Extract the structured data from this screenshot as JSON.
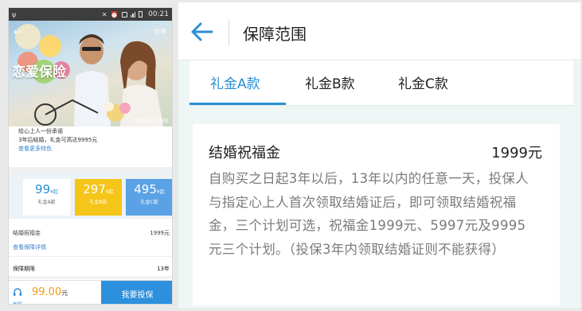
{
  "phone": {
    "status": {
      "time": "00:21"
    },
    "hero": {
      "share": "分享",
      "title": "恋爱保险"
    },
    "intro": {
      "line1": "给心上人一份承诺",
      "line2": "3年后结婚，礼金可高达9995元",
      "more": "查看更多特色"
    },
    "plans": [
      {
        "amount": "99",
        "unit": "¥起",
        "name": "礼金A款"
      },
      {
        "amount": "297",
        "unit": "¥起",
        "name": "礼金B款"
      },
      {
        "amount": "495",
        "unit": "¥起",
        "name": "礼金C款"
      }
    ],
    "coverage_row": {
      "label": "结婚祝福金",
      "value": "1999元"
    },
    "coverage_link": "查看保障详情",
    "period_row": {
      "label": "保障期限",
      "value": "13年"
    },
    "bottom": {
      "service_label": "客服",
      "price": "99.00",
      "price_unit": "元",
      "buy": "我要投保"
    }
  },
  "detail": {
    "title": "保障范围",
    "tabs": [
      "礼金A款",
      "礼金B款",
      "礼金C款"
    ],
    "active_tab": 0,
    "card": {
      "title": "结婚祝福金",
      "amount": "1999元",
      "description": "自购买之日起3年以后，13年以内的任意一天，投保人与指定心上人首次领取结婚证后，即可领取结婚祝福金，三个计划可选，祝福金1999元、5997元及9995元三个计划。（投保3年内领取结婚证则不能获得）"
    }
  },
  "colors": {
    "accent": "#2a8fd5",
    "price": "#f29a1b",
    "plan_b": "#f5c518",
    "plan_c": "#5aa2e5"
  }
}
